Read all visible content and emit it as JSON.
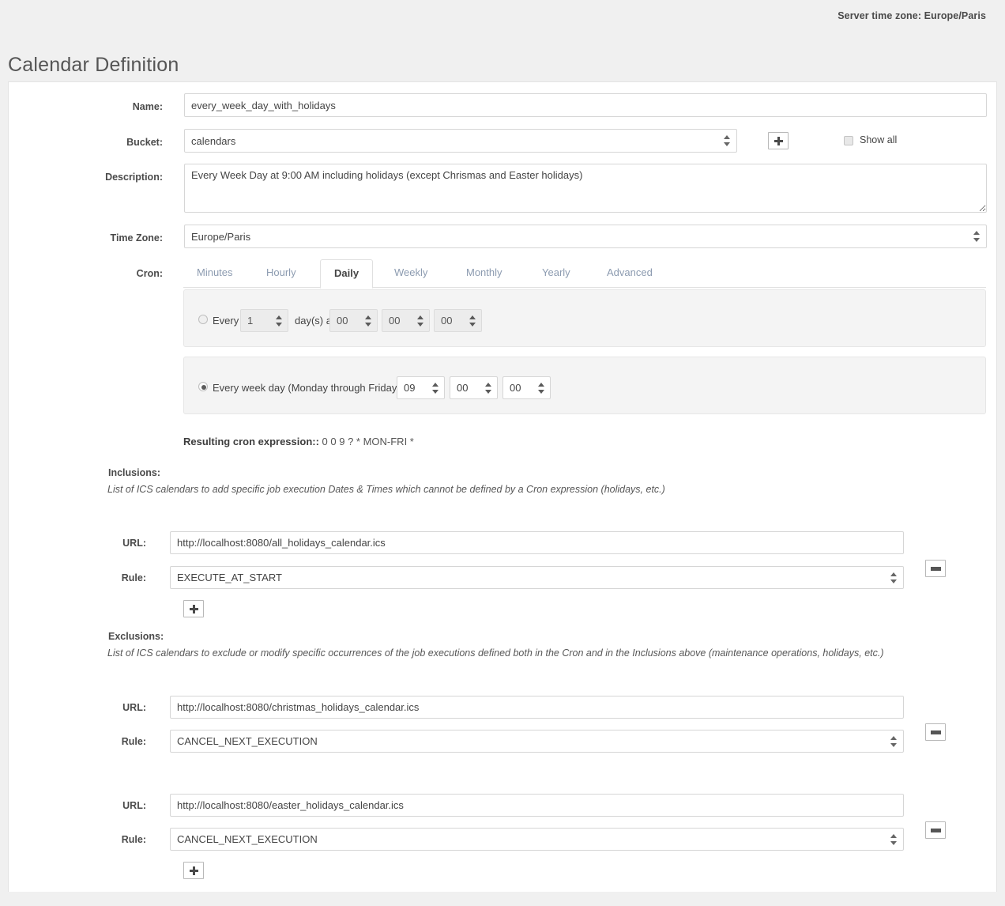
{
  "header": {
    "server_timezone_label": "Server time zone: Europe/Paris"
  },
  "page_title": "Calendar Definition",
  "form": {
    "name": {
      "label": "Name:",
      "value": "every_week_day_with_holidays"
    },
    "bucket": {
      "label": "Bucket:",
      "value": "calendars",
      "add_button_icon": "plus-icon",
      "show_all_label": "Show all",
      "show_all_checked": false
    },
    "description": {
      "label": "Description:",
      "value": "Every Week Day at 9:00 AM including holidays (except Chrismas and Easter holidays)"
    },
    "timezone": {
      "label": "Time Zone:",
      "value": "Europe/Paris"
    },
    "cron": {
      "label": "Cron:",
      "tabs": [
        {
          "label": "Minutes",
          "active": false
        },
        {
          "label": "Hourly",
          "active": false
        },
        {
          "label": "Daily",
          "active": true
        },
        {
          "label": "Weekly",
          "active": false
        },
        {
          "label": "Monthly",
          "active": false
        },
        {
          "label": "Yearly",
          "active": false
        },
        {
          "label": "Advanced",
          "active": false
        }
      ],
      "option_every_days": {
        "selected": false,
        "prefix": "Every",
        "days_value": "1",
        "middle": "day(s) at",
        "hour": "00",
        "minute": "00",
        "second": "00"
      },
      "option_week_day": {
        "selected": true,
        "text": "Every week day (Monday through Friday) at",
        "hour": "09",
        "minute": "00",
        "second": "00"
      },
      "result_label": "Resulting cron expression::",
      "result_value": "0 0 9 ? * MON-FRI *"
    },
    "inclusions": {
      "label": "Inclusions:",
      "help": "List of ICS calendars to add specific job execution Dates & Times which cannot be defined by a Cron expression (holidays, etc.)",
      "entries": [
        {
          "url_label": "URL:",
          "url_value": "http://localhost:8080/all_holidays_calendar.ics",
          "rule_label": "Rule:",
          "rule_value": "EXECUTE_AT_START"
        }
      ],
      "add_button_icon": "plus-icon",
      "remove_button_icon": "minus-icon"
    },
    "exclusions": {
      "label": "Exclusions:",
      "help": "List of ICS calendars to exclude or modify specific occurrences of the job executions defined both in the Cron and in the Inclusions above (maintenance operations, holidays, etc.)",
      "entries": [
        {
          "url_label": "URL:",
          "url_value": "http://localhost:8080/christmas_holidays_calendar.ics",
          "rule_label": "Rule:",
          "rule_value": "CANCEL_NEXT_EXECUTION"
        },
        {
          "url_label": "URL:",
          "url_value": "http://localhost:8080/easter_holidays_calendar.ics",
          "rule_label": "Rule:",
          "rule_value": "CANCEL_NEXT_EXECUTION"
        }
      ],
      "add_button_icon": "plus-icon",
      "remove_button_icon": "minus-icon"
    }
  },
  "colors": {
    "page_background": "#f0f0f0",
    "panel_background": "#ffffff",
    "tab_inactive": "#8c9bb0",
    "text": "#444444"
  }
}
